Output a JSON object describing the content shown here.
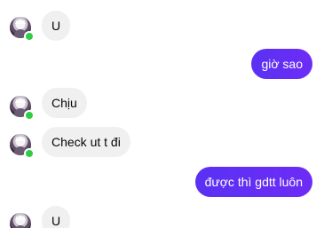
{
  "conversation": {
    "messages": [
      {
        "sender": "other",
        "text": "U"
      },
      {
        "sender": "me",
        "text": "giờ sao"
      },
      {
        "sender": "other",
        "text": "Chịu"
      },
      {
        "sender": "other",
        "text": "Check ut t đi"
      },
      {
        "sender": "me",
        "text": "được thì gdtt luôn"
      },
      {
        "sender": "other",
        "text": "U"
      }
    ]
  },
  "colors": {
    "incoming_bubble": "#f0f0f0",
    "outgoing_bubble": "#5a31f4",
    "online_indicator": "#31cc46"
  }
}
